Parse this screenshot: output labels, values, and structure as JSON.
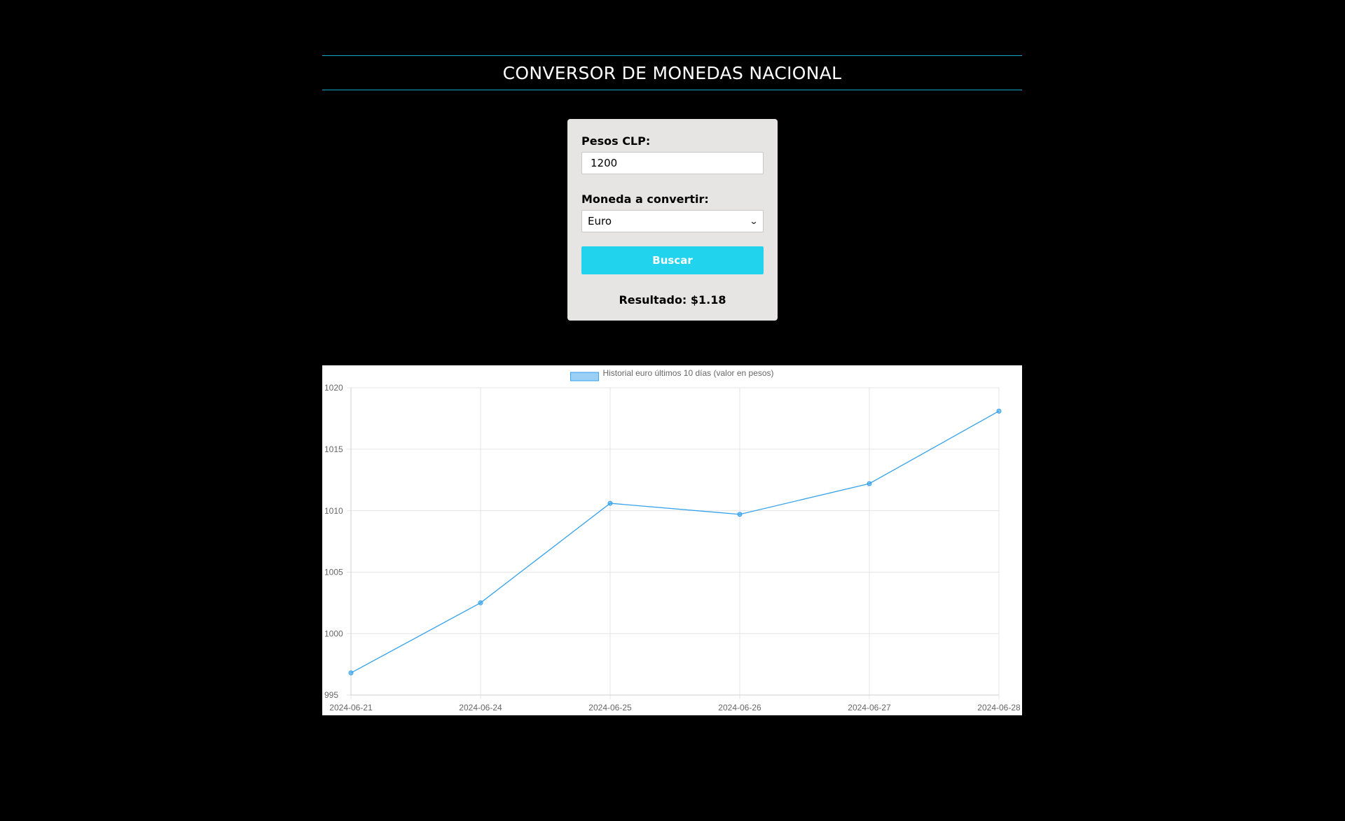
{
  "header": {
    "title": "CONVERSOR DE MONEDAS NACIONAL"
  },
  "form": {
    "amount_label": "Pesos CLP:",
    "amount_value": "1200",
    "currency_label": "Moneda a convertir:",
    "currency_selected": "Euro",
    "search_label": "Buscar",
    "result_text": "Resultado: $1.18"
  },
  "colors": {
    "background": "#000000",
    "accent": "#22d3ee",
    "line": "#36a2eb",
    "card": "#e6e5e3"
  },
  "chart_data": {
    "type": "line",
    "categories": [
      "2024-06-21",
      "2024-06-24",
      "2024-06-25",
      "2024-06-26",
      "2024-06-27",
      "2024-06-28"
    ],
    "series": [
      {
        "name": "Historial euro últimos 10 días (valor en pesos)",
        "values": [
          996.8,
          1002.5,
          1010.6,
          1009.7,
          1012.2,
          1018.1
        ]
      }
    ],
    "ylim": [
      995,
      1020
    ],
    "yticks": [
      "1020",
      "1015",
      "1010",
      "1005",
      "1000",
      "995"
    ],
    "legend": "top-center",
    "grid": true
  }
}
